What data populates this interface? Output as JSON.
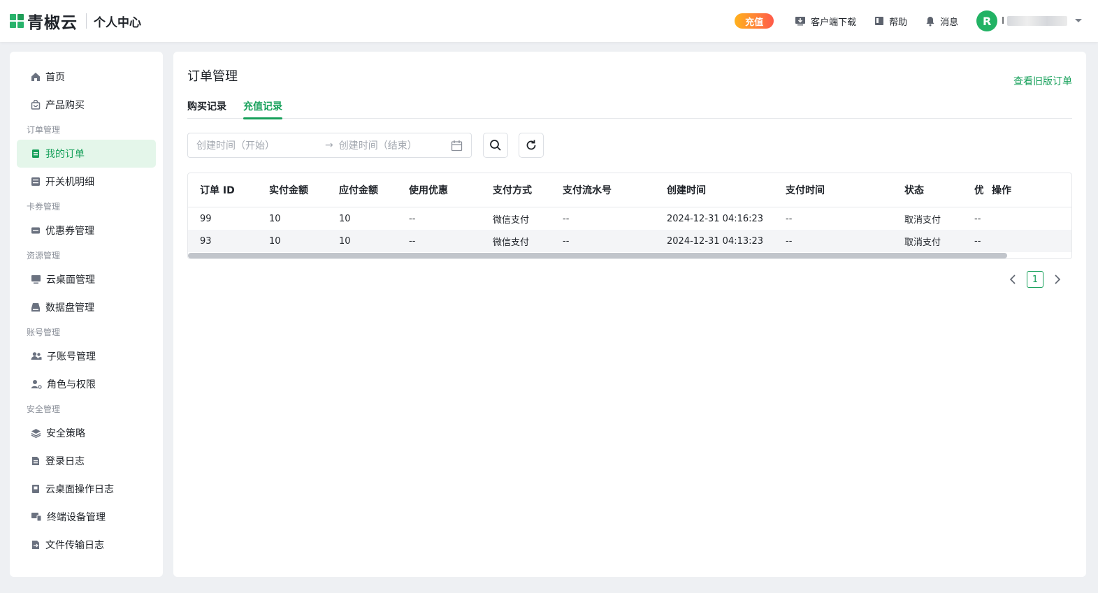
{
  "header": {
    "logo_text": "青椒云",
    "subtitle": "个人中心",
    "recharge_label": "充值",
    "download_label": "客户端下载",
    "help_label": "帮助",
    "messages_label": "消息",
    "avatar_initial": "R",
    "user_name_visible": "I"
  },
  "sidebar": {
    "home": "首页",
    "purchase": "产品购买",
    "group_orders": "订单管理",
    "my_orders": "我的订单",
    "power_detail": "开关机明细",
    "group_cards": "卡券管理",
    "coupons": "优惠券管理",
    "group_resources": "资源管理",
    "desktops": "云桌面管理",
    "disks": "数据盘管理",
    "group_accounts": "账号管理",
    "sub_accounts": "子账号管理",
    "roles": "角色与权限",
    "group_security": "安全管理",
    "policies": "安全策略",
    "login_logs": "登录日志",
    "desktop_logs": "云桌面操作日志",
    "devices": "终端设备管理",
    "transfer_logs": "文件传输日志"
  },
  "main": {
    "title": "订单管理",
    "old_orders_link": "查看旧版订单",
    "tabs": [
      "购买记录",
      "充值记录"
    ],
    "date_start_placeholder": "创建时间（开始）",
    "date_arrow": "→",
    "date_end_placeholder": "创建时间（结束）",
    "columns": [
      "订单 ID",
      "实付金额",
      "应付金额",
      "使用优惠",
      "支付方式",
      "支付流水号",
      "创建时间",
      "支付时间",
      "状态",
      "优",
      "操作"
    ],
    "rows": [
      [
        "99",
        "10",
        "10",
        "--",
        "微信支付",
        "--",
        "2024-12-31 04:16:23",
        "--",
        "取消支付",
        "--",
        ""
      ],
      [
        "93",
        "10",
        "10",
        "--",
        "微信支付",
        "--",
        "2024-12-31 04:13:23",
        "--",
        "取消支付",
        "--",
        ""
      ]
    ],
    "current_page": "1"
  },
  "colors": {
    "accent": "#16a05a",
    "active_bg": "#e4f6ea",
    "recharge_gradient_start": "#ffb21d",
    "recharge_gradient_end": "#ff5a4a"
  }
}
